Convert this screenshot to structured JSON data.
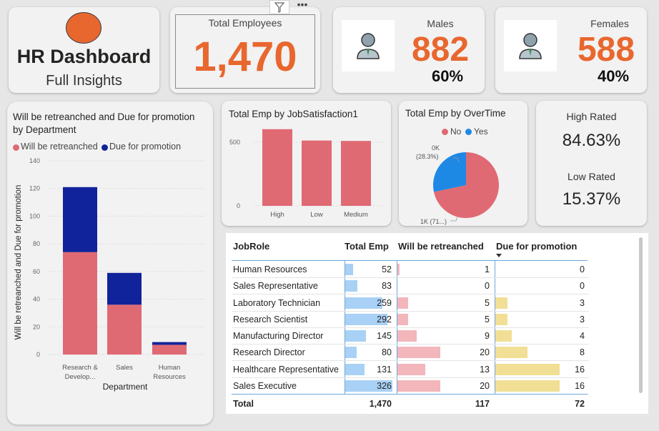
{
  "title_card": {
    "title": "HR Dashboard",
    "subtitle": "Full Insights"
  },
  "total_card": {
    "label": "Total Employees",
    "value": "1,470"
  },
  "males_card": {
    "label": "Males",
    "value": "882",
    "pct": "60%"
  },
  "females_card": {
    "label": "Females",
    "value": "588",
    "pct": "40%"
  },
  "rating_card": {
    "high_label": "High Rated",
    "high_value": "84.63%",
    "low_label": "Low Rated",
    "low_value": "15.37%"
  },
  "colors": {
    "accent": "#e8672f",
    "retrenched": "#e06a74",
    "promotion": "#11239a",
    "yes": "#1e88e5",
    "total_bar": "#a8d1f5",
    "retr_bar": "#f2b6bb",
    "promo_bar": "#f1df95"
  },
  "icons": {
    "filter": "filter-icon",
    "more": "more-options-icon",
    "avatar": "person-icon"
  },
  "dept_chart": {
    "title": "Will be retreanched and Due for promotion by Department",
    "legend": [
      "Will be retreanched",
      "Due for promotion"
    ],
    "ylabel": "Will be retreanched and Due for promotion",
    "xlabel": "Department",
    "ticks": [
      "140",
      "120",
      "100",
      "80",
      "60",
      "40",
      "20",
      "0"
    ],
    "cat_labels": [
      [
        "Research &",
        "Develop..."
      ],
      [
        "Sales",
        ""
      ],
      [
        "Human",
        "Resources"
      ]
    ]
  },
  "js_chart": {
    "title": "Total Emp by JobSatisfaction1",
    "ticks": [
      "500",
      "0"
    ],
    "labels": [
      "High",
      "Low",
      "Medium"
    ]
  },
  "ot_chart": {
    "title": "Total Emp by OverTime",
    "legend": [
      "No",
      "Yes"
    ],
    "label_yes": "0K",
    "label_yes2": "(28.3%)",
    "label_no": "1K (71...)"
  },
  "table": {
    "headers": [
      "JobRole",
      "Total Emp",
      "Will be retreanched",
      "Due for promotion"
    ],
    "rows": [
      [
        "Human Resources",
        "52",
        "1",
        "0"
      ],
      [
        "Sales Representative",
        "83",
        "0",
        "0"
      ],
      [
        "Laboratory Technician",
        "259",
        "5",
        "3"
      ],
      [
        "Research Scientist",
        "292",
        "5",
        "3"
      ],
      [
        "Manufacturing Director",
        "145",
        "9",
        "4"
      ],
      [
        "Research Director",
        "80",
        "20",
        "8"
      ],
      [
        "Healthcare Representative",
        "131",
        "13",
        "16"
      ],
      [
        "Sales Executive",
        "326",
        "20",
        "16"
      ]
    ],
    "total": [
      "Total",
      "1,470",
      "117",
      "72"
    ]
  },
  "chart_data": [
    {
      "type": "bar",
      "title": "Will be retreanched and Due for promotion by Department",
      "xlabel": "Department",
      "ylabel": "Will be retreanched and Due for promotion",
      "categories": [
        "Research & Develop...",
        "Sales",
        "Human Resources"
      ],
      "series": [
        {
          "name": "Will be retreanched",
          "values": [
            74,
            36,
            7
          ]
        },
        {
          "name": "Due for promotion",
          "values": [
            47,
            23,
            2
          ]
        }
      ],
      "stacked": true,
      "ylim": [
        0,
        140
      ]
    },
    {
      "type": "bar",
      "title": "Total Emp by JobSatisfaction1",
      "categories": [
        "High",
        "Low",
        "Medium"
      ],
      "values": [
        601,
        512,
        509
      ],
      "ylim": [
        0,
        650
      ]
    },
    {
      "type": "pie",
      "title": "Total Emp by OverTime",
      "categories": [
        "No",
        "Yes"
      ],
      "values": [
        71.7,
        28.3
      ]
    }
  ]
}
